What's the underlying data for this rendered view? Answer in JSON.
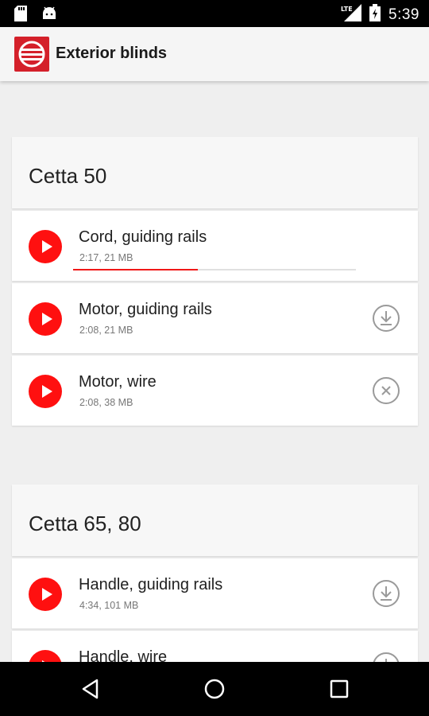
{
  "status_bar": {
    "time": "5:39",
    "icons": [
      "sd-card-icon",
      "android-icon",
      "lte-signal-icon",
      "battery-charging-icon"
    ],
    "network_label": "LTE"
  },
  "app_bar": {
    "title": "Exterior blinds",
    "logo_color": "#d4202a"
  },
  "sections": [
    {
      "title": "Cetta 50",
      "items": [
        {
          "title": "Cord, guiding rails",
          "meta": "2:17, 21 MB",
          "action": "downloading",
          "progress_percent": 44
        },
        {
          "title": "Motor, guiding rails",
          "meta": "2:08, 21 MB",
          "action": "download-icon"
        },
        {
          "title": "Motor, wire",
          "meta": "2:08, 38 MB",
          "action": "cancel-icon"
        }
      ]
    },
    {
      "title": "Cetta 65, 80",
      "items": [
        {
          "title": "Handle, guiding rails",
          "meta": "4:34, 101 MB",
          "action": "download-icon"
        },
        {
          "title": "Handle, wire",
          "meta": "",
          "action": "download-icon"
        }
      ]
    }
  ],
  "colors": {
    "accent": "#ff1010",
    "background": "#efefef"
  },
  "nav_bar": {
    "buttons": [
      "back-icon",
      "home-icon",
      "recents-icon"
    ]
  }
}
